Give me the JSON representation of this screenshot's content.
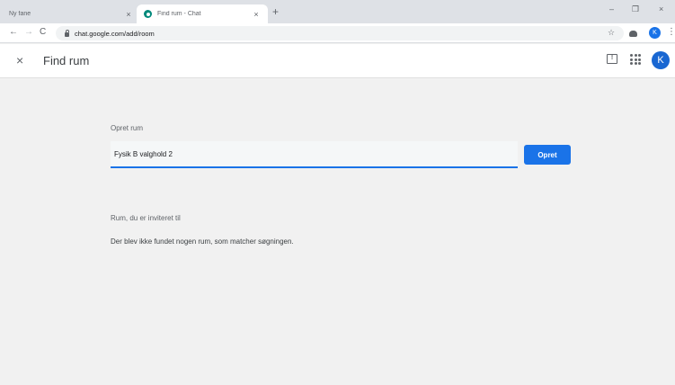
{
  "browser": {
    "tabs": [
      {
        "title": "Ny fane",
        "close": "×"
      },
      {
        "title": "Find rum - Chat",
        "close": "×"
      }
    ],
    "new_tab": "+",
    "window_controls": {
      "minimize": "–",
      "restore": "❐",
      "close": "×"
    },
    "nav": {
      "back": "←",
      "forward": "→",
      "reload": "C"
    },
    "url": "chat.google.com/add/room",
    "profile_initial": "K",
    "menu": "⋮",
    "star": "☆"
  },
  "app_header": {
    "close": "×",
    "title": "Find rum",
    "feedback_glyph": "!",
    "avatar_initial": "K"
  },
  "create_room": {
    "label": "Opret rum",
    "input_value": "Fysik B valghold 2",
    "button_label": "Opret"
  },
  "invited": {
    "label": "Rum, du er inviteret til",
    "empty_message": "Der blev ikke fundet nogen rum, som matcher søgningen."
  },
  "colors": {
    "accent": "#1a73e8",
    "background": "#f1f1f1"
  }
}
